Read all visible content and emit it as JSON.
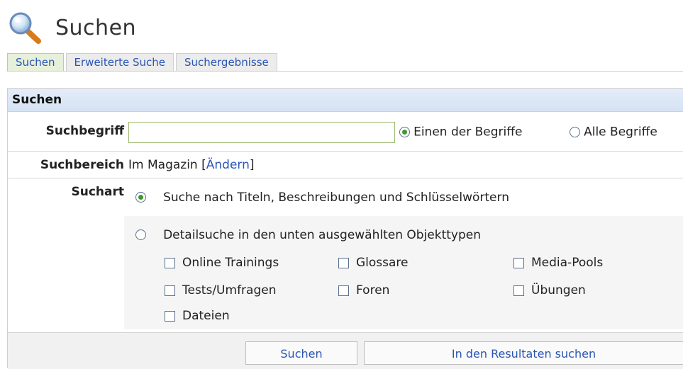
{
  "page": {
    "title": "Suchen",
    "icon": "magnifier-icon"
  },
  "tabs": [
    {
      "label": "Suchen",
      "active": true
    },
    {
      "label": "Erweiterte Suche",
      "active": false
    },
    {
      "label": "Suchergebnisse",
      "active": false
    }
  ],
  "form": {
    "header": "Suchen",
    "term": {
      "label": "Suchbegriff",
      "value": "",
      "mode_options": [
        {
          "label": "Einen der Begriffe",
          "selected": true
        },
        {
          "label": "Alle Begriffe",
          "selected": false
        }
      ]
    },
    "scope": {
      "label": "Suchbereich",
      "text": "Im Magazin",
      "open_bracket": "[",
      "change_link": "Ändern",
      "close_bracket": "]"
    },
    "type": {
      "label": "Suchart",
      "options": [
        {
          "label": "Suche nach Titeln, Beschreibungen und Schlüsselwörtern",
          "selected": true
        },
        {
          "label": "Detailsuche in den unten ausgewählten Objekttypen",
          "selected": false
        }
      ],
      "object_types": [
        {
          "label": "Online Trainings",
          "checked": false
        },
        {
          "label": "Glossare",
          "checked": false
        },
        {
          "label": "Media-Pools",
          "checked": false
        },
        {
          "label": "Tests/Umfragen",
          "checked": false
        },
        {
          "label": "Foren",
          "checked": false
        },
        {
          "label": "Übungen",
          "checked": false
        },
        {
          "label": "Dateien",
          "checked": false
        }
      ]
    },
    "buttons": {
      "search": "Suchen",
      "search_in_results": "In den Resultaten suchen"
    }
  },
  "colors": {
    "link": "#2a55b5",
    "radio_dot": "#3c9a2f",
    "header_bg": "#d5e2f3",
    "active_tab_bg": "#e7f0da"
  }
}
